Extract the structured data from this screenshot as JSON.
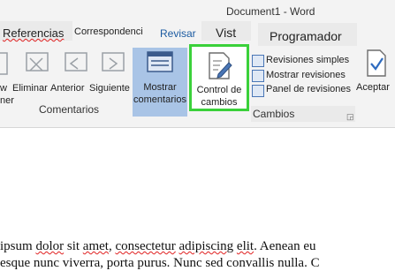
{
  "window": {
    "title": "Document1 - Word"
  },
  "tabs": {
    "references": "Referencias",
    "mailings": "Correspondenci",
    "review": "Revisar",
    "view": "Vist",
    "developer": "Programador"
  },
  "comments_group": {
    "new_fragment": "w",
    "new_fragment2": "ner",
    "delete": "Eliminar",
    "previous": "Anterior",
    "next": "Siguiente",
    "show_comments_line1": "Mostrar",
    "show_comments_line2": "comentarios",
    "label": "Comentarios"
  },
  "tracking_group": {
    "track_changes_line1": "Control de",
    "track_changes_line2": "cambios",
    "simple_markup": "Revisiones simples",
    "show_markup": "Mostrar revisiones",
    "reviewing_pane": "Panel de revisiones",
    "label": "Cambios"
  },
  "changes_group": {
    "accept": "Aceptar"
  },
  "document": {
    "line1": {
      "pre": " ipsum ",
      "w1": "dolor",
      "mid1": " sit ",
      "w2": "amet",
      "mid2": ", ",
      "w3": "consectetur",
      "mid3": " ",
      "w4": "adipiscing",
      "mid4": " ",
      "w5": "elit",
      "mid5": ". Aenean eu"
    },
    "line2": "esque nunc viverra, porta purus. Nunc sed convallis nulla. C"
  }
}
